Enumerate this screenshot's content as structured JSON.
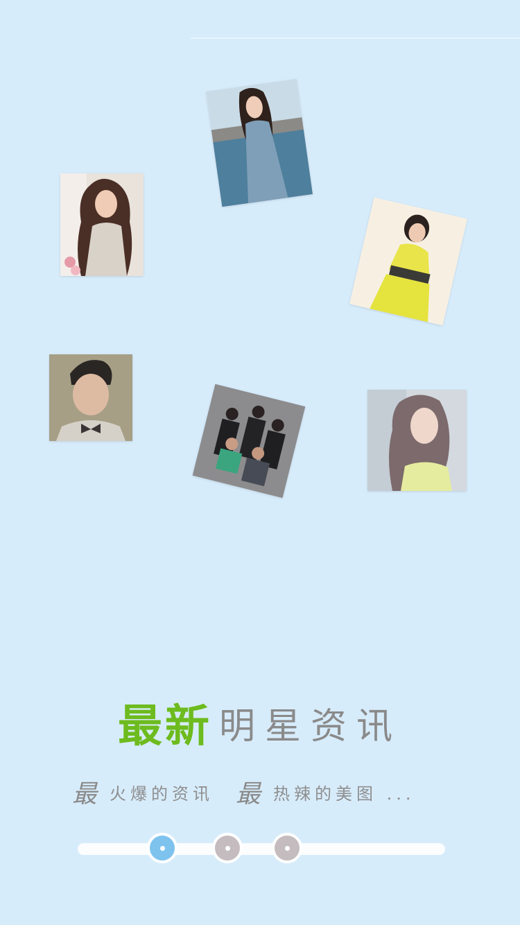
{
  "photos": [
    {
      "name": "star-photo-1",
      "subject": "woman in white lace dress"
    },
    {
      "name": "star-photo-2",
      "subject": "woman in blue dress by the sea"
    },
    {
      "name": "star-photo-3",
      "subject": "woman in yellow dress"
    },
    {
      "name": "star-photo-4",
      "subject": "man with bow tie"
    },
    {
      "name": "star-photo-5",
      "subject": "band group photo"
    },
    {
      "name": "star-photo-6",
      "subject": "woman with long hair"
    }
  ],
  "title": {
    "highlight": "最新",
    "rest": "明星资讯"
  },
  "tagline": {
    "prefix_1": "最",
    "text_1": "火爆的资讯",
    "prefix_2": "最",
    "text_2": "热辣的美图 ..."
  },
  "pager": {
    "total": 3,
    "current": 1
  },
  "colors": {
    "background": "#d7ecfb",
    "accent_green": "#6dbb1e",
    "title_gray": "#8a8a8a",
    "dot_active": "#7ec3ee",
    "dot_inactive": "#c4bcbe"
  }
}
